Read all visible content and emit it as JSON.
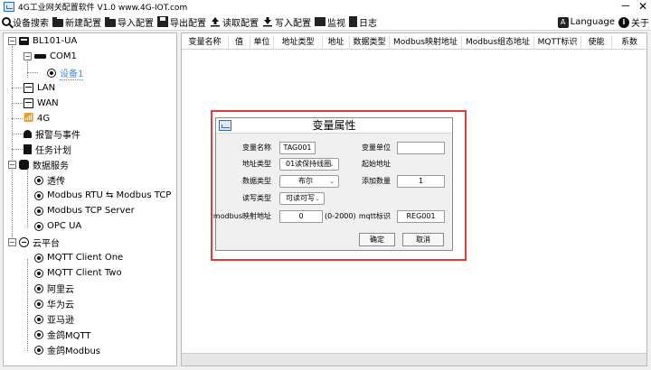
{
  "window": {
    "title": "4G工业网关配置软件 V1.0 www.4G-IOT.com",
    "minimize": "－",
    "close": "✕"
  },
  "toolbar": {
    "search": "设备搜索",
    "new_config": "新建配置",
    "import_config": "导入配置",
    "export_config": "导出配置",
    "read_config": "读取配置",
    "write_config": "写入配置",
    "monitor": "监视",
    "log": "日志",
    "language": "Language",
    "about": "关于"
  },
  "tree": {
    "root": "BL101-UA",
    "com1": "COM1",
    "device1": "设备1",
    "lan": "LAN",
    "wan": "WAN",
    "g4": "4G",
    "alarm": "报警与事件",
    "task": "任务计划",
    "data_service": "数据服务",
    "transparent": "透传",
    "modbus_rtu_tcp": "Modbus RTU ⇆ Modbus TCP",
    "modbus_tcp_server": "Modbus TCP Server",
    "opc_ua": "OPC UA",
    "cloud": "云平台",
    "mqtt_one": "MQTT Client One",
    "mqtt_two": "MQTT Client Two",
    "aliyun": "阿里云",
    "huawei": "华为云",
    "amazon": "亚马逊",
    "jinge_mqtt": "金鸽MQTT",
    "jinge_modbus": "金鸽Modbus"
  },
  "grid": {
    "columns": [
      "变量名称",
      "值",
      "单位",
      "地址类型",
      "地址",
      "数据类型",
      "Modbus映射地址",
      "Modbus组态地址",
      "MQTT标识",
      "使能",
      "系数"
    ]
  },
  "dialog": {
    "title": "变量属性",
    "name_label": "变量名称",
    "name_value": "TAG001",
    "unit_label": "变量单位",
    "unit_value": "",
    "addr_type_label": "地址类型",
    "addr_type_value": "01读保持线圈",
    "start_addr_label": "起始地址",
    "data_type_label": "数据类型",
    "data_type_value": "布尔",
    "add_count_label": "添加数量",
    "add_count_value": "1",
    "rw_label": "读写类型",
    "rw_value": "可读可写",
    "modbus_map_label": "modbus映射地址",
    "modbus_map_value": "0",
    "modbus_map_range": "(0-2000)",
    "mqtt_label": "mqtt标识",
    "mqtt_value": "REG001",
    "ok": "确定",
    "cancel": "取消"
  }
}
